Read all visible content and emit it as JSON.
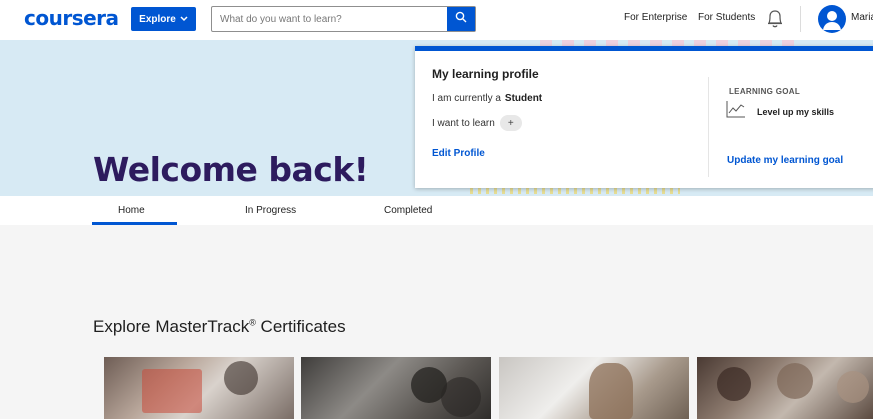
{
  "header": {
    "logo": "coursera",
    "explore_label": "Explore",
    "search_placeholder": "What do you want to learn?",
    "nav_enterprise": "For Enterprise",
    "nav_students": "For Students",
    "user_name": "Maria",
    "icons": [
      "chevron-down-icon",
      "search-icon",
      "bell-icon",
      "avatar-icon"
    ]
  },
  "hero": {
    "welcome": "Welcome back!"
  },
  "profile": {
    "title": "My learning profile",
    "current_prefix": "I am currently a",
    "current_role": "Student",
    "learn_prefix": "I want to learn",
    "add_label": "+",
    "edit_label": "Edit Profile",
    "goal_heading": "LEARNING GOAL",
    "goal_text": "Level up my skills",
    "update_label": "Update my learning goal"
  },
  "tabs": [
    {
      "label": "Home",
      "active": true
    },
    {
      "label": "In Progress",
      "active": false
    },
    {
      "label": "Completed",
      "active": false
    }
  ],
  "section": {
    "title_main": "Explore MasterTrack",
    "title_sup": "®",
    "title_end": " Certificates"
  },
  "colors": {
    "brand": "#0056d2",
    "hero_bg": "#d7eaf4",
    "welcome": "#2d1b5e"
  }
}
